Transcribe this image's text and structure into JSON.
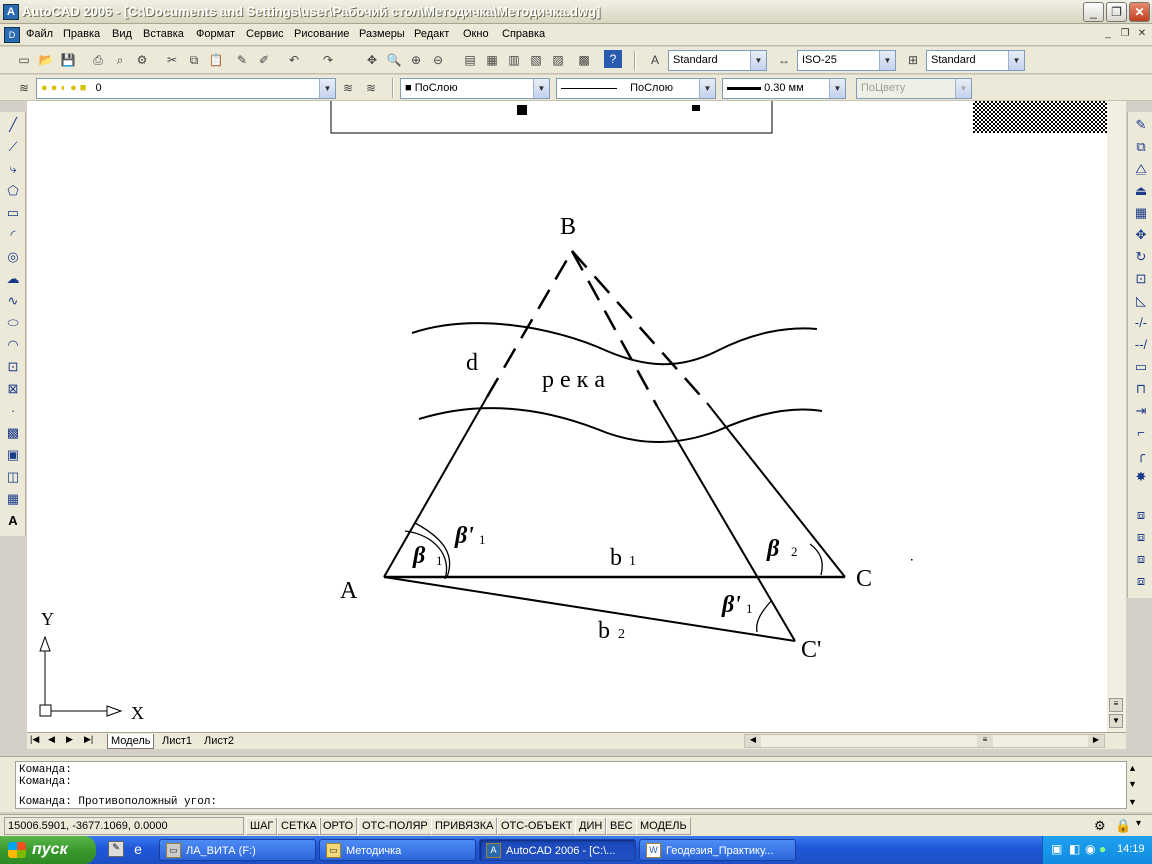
{
  "window": {
    "title": "AutoCAD 2006 - [C:\\Documents and Settings\\user\\Рабочий стол\\Методичка\\Методичка.dwg]",
    "app_icon": "autocad-icon",
    "minimize": "_",
    "restore": "❐",
    "close": "✕"
  },
  "menu": [
    "Файл",
    "Правка",
    "Вид",
    "Вставка",
    "Формат",
    "Сервис",
    "Рисование",
    "Размеры",
    "Редакт",
    "Окно",
    "Справка"
  ],
  "doc_controls": [
    "_",
    "❐",
    "✕"
  ],
  "toolbar_styles": {
    "text_style": "Standard",
    "dim_style": "ISO-25",
    "table_style": "Standard"
  },
  "layers_bar": {
    "layer_name": "0",
    "color": "ПоСлою",
    "linetype": "ПоСлою",
    "lineweight": "0.30 мм",
    "plotstyle": "ПоЦвету"
  },
  "drawing": {
    "label_B": "B",
    "label_A": "A",
    "label_C": "C",
    "label_C2": "C'",
    "label_d": "d",
    "river": "р е к а",
    "label_b1": "b",
    "sub_b1": "1",
    "label_b2": "b",
    "sub_b2": "2",
    "beta": "β",
    "beta_prime": "β'",
    "sub1": "1",
    "sub2": "2",
    "ucs_x": "X",
    "ucs_y": "Y"
  },
  "tabs": [
    "Модель",
    "Лист1",
    "Лист2"
  ],
  "command_lines": [
    "Команда:",
    "Команда:",
    "Команда: Противоположный угол:"
  ],
  "status": {
    "coords": "15006.5901, -3677.1069, 0.0000",
    "toggles": [
      "ШАГ",
      "СЕТКА",
      "ОРТО",
      "ОТС-ПОЛЯР",
      "ПРИВЯЗКА",
      "ОТС-ОБЪЕКТ",
      "ДИН",
      "ВЕС",
      "МОДЕЛЬ"
    ]
  },
  "taskbar": {
    "start": "пуск",
    "tasks": [
      "ЛА_ВИТА (F:)",
      "Методичка",
      "AutoCAD 2006 - [C:\\...",
      "Геодезия_Практику..."
    ],
    "clock": "14:19"
  }
}
